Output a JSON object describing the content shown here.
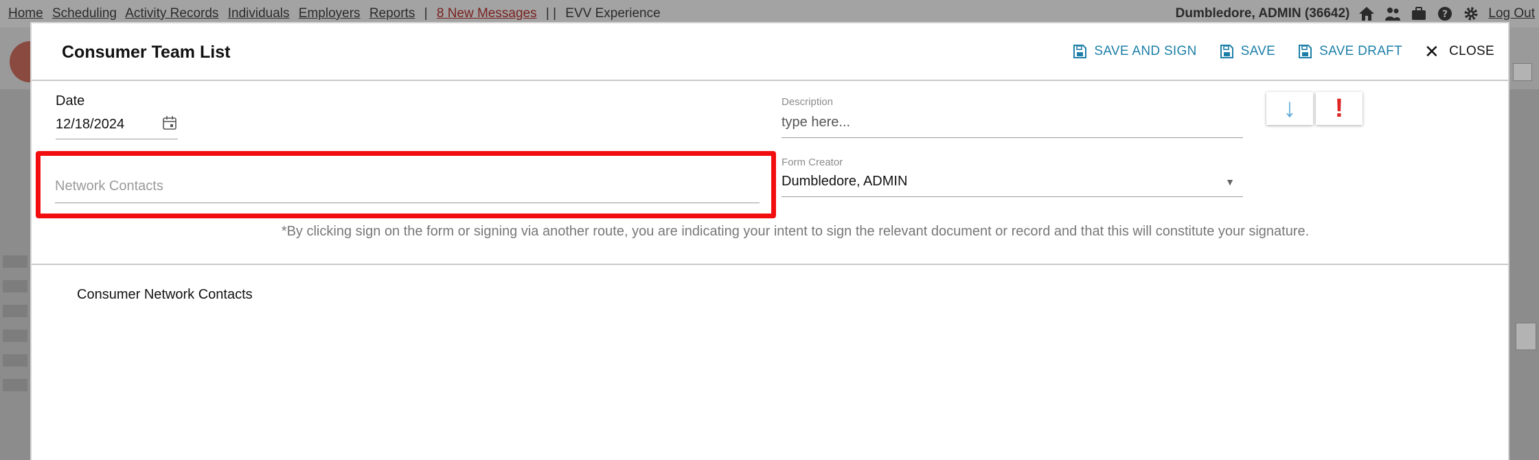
{
  "topnav": {
    "links": [
      "Home",
      "Scheduling",
      "Activity Records",
      "Individuals",
      "Employers",
      "Reports"
    ],
    "messages": "8 New Messages",
    "separator": "|  |",
    "evv": "EVV Experience",
    "user": "Dumbledore, ADMIN  (36642)",
    "logout": "Log Out",
    "icons": [
      "home-icon",
      "users-icon",
      "briefcase-icon",
      "help-icon",
      "gear-icon"
    ]
  },
  "modal": {
    "title": "Consumer Team List",
    "actions": {
      "save_and_sign": "SAVE AND SIGN",
      "save": "SAVE",
      "save_draft": "SAVE DRAFT",
      "close": "CLOSE",
      "close_glyph": "✕"
    },
    "date": {
      "label": "Date",
      "value": "12/18/2024"
    },
    "description": {
      "label": "Description",
      "placeholder": "type here..."
    },
    "icon_buttons": {
      "down_glyph": "↓",
      "alert_glyph": "!"
    },
    "network_contacts": {
      "placeholder": "Network Contacts"
    },
    "form_creator": {
      "label": "Form Creator",
      "value": "Dumbledore, ADMIN"
    },
    "disclaimer": "*By clicking sign on the form or signing via another route, you are indicating your intent to sign the relevant document or record and that this will constitute your signature.",
    "section_label": "Consumer Network Contacts"
  },
  "colors": {
    "accent": "#1d7fa8",
    "highlight": "#f20e0e",
    "alert": "#e02424",
    "arrow": "#5aa8d6"
  }
}
